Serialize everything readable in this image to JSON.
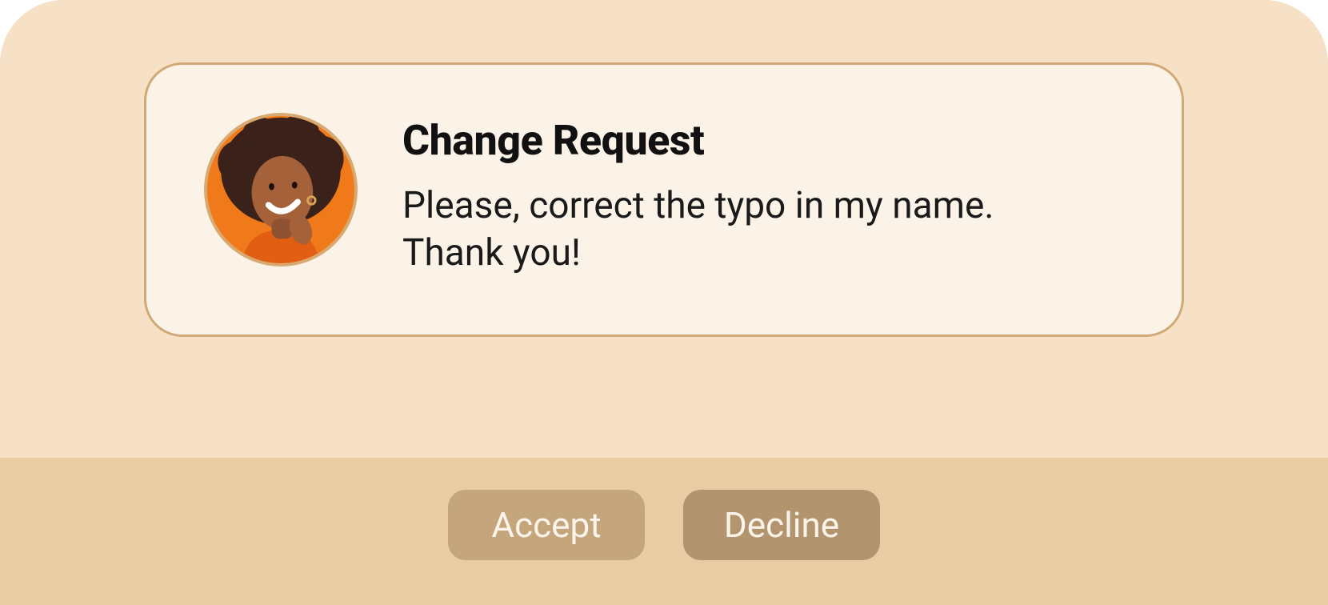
{
  "card": {
    "title": "Change Request",
    "message": "Please, correct the typo in my name. Thank you!",
    "avatar_alt": "user-avatar"
  },
  "actions": {
    "accept_label": "Accept",
    "decline_label": "Decline"
  },
  "colors": {
    "panel_top": "#f7e1c6",
    "panel_bottom": "#e9cca4",
    "card_bg": "#fcf3e8",
    "card_border": "#d1a977",
    "btn_accept": "#c4a57c",
    "btn_decline": "#b2956e",
    "avatar_bg": "#f07a1a"
  }
}
